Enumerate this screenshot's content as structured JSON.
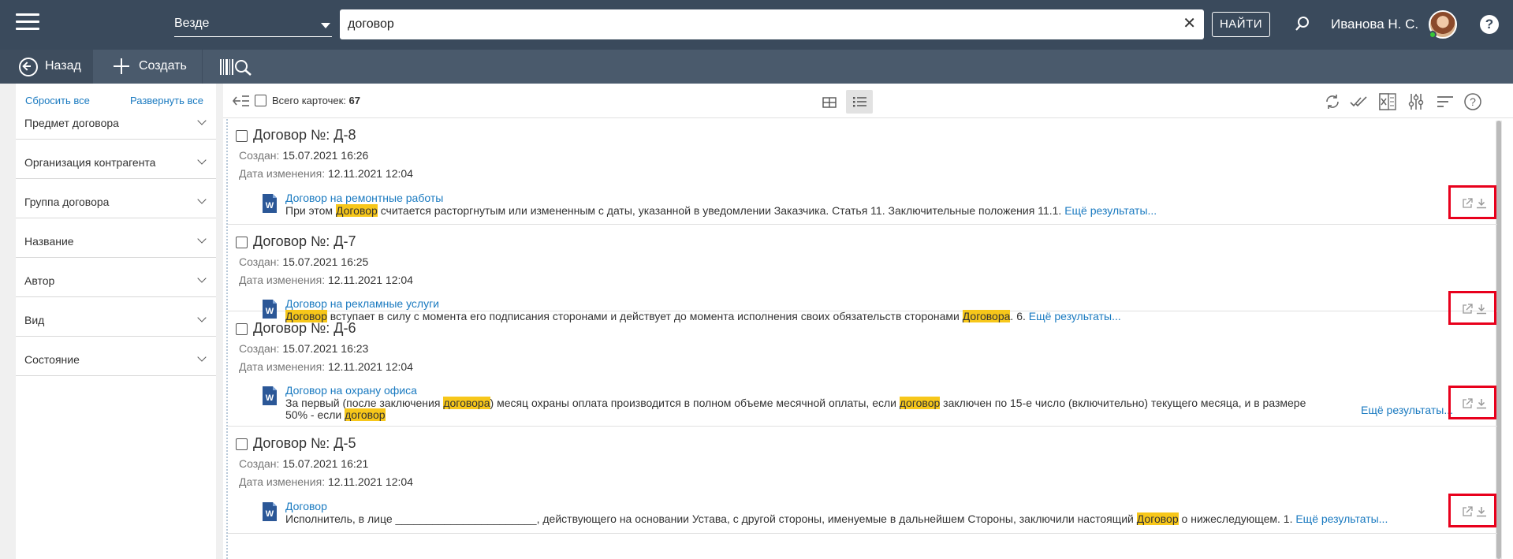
{
  "topbar": {
    "scope": "Везде",
    "search_value": "договор",
    "search_placeholder": "",
    "clear_glyph": "✕",
    "find_label": "НАЙТИ",
    "user_name": "Иванова Н. С.",
    "help_glyph": "?"
  },
  "toolbar": {
    "back_label": "Назад",
    "create_label": "Создать"
  },
  "filters": {
    "reset_label": "Сбросить все",
    "expand_label": "Развернуть все",
    "facets": [
      "Предмет договора",
      "Организация контрагента",
      "Группа договора",
      "Название",
      "Автор",
      "Вид",
      "Состояние"
    ]
  },
  "results": {
    "total_label": "Всего карточек:",
    "total_count": "67",
    "created_label": "Создан:",
    "modified_label": "Дата изменения:",
    "more_label": "Ещё результаты...",
    "cards": [
      {
        "title": "Договор №: Д-8",
        "created": "15.07.2021 16:26",
        "modified": "12.11.2021 12:04",
        "doc_title": "Договор на ремонтные работы",
        "snippet": [
          "При этом ",
          "Договор",
          " считается расторгнутым или измененным с даты, указанной в уведомлении Заказчика. Статья 11. Заключительные положения 11.1. "
        ]
      },
      {
        "title": "Договор №: Д-7",
        "created": "15.07.2021 16:25",
        "modified": "12.11.2021 12:04",
        "doc_title": "Договор на рекламные услуги",
        "snippet": [
          "Договор",
          " вступает в силу с момента его подписания сторонами и действует до момента исполнения своих обязательств сторонами ",
          "Договора",
          ". 6. "
        ]
      },
      {
        "title": "Договор №: Д-6",
        "created": "15.07.2021 16:23",
        "modified": "12.11.2021 12:04",
        "doc_title": "Договор на охрану офиса",
        "snippet": [
          "За первый (после заключения ",
          "договора",
          ") месяц охраны оплата производится в полном объеме месячной оплаты, если ",
          "договор",
          " заключен по 15-е число (включительно) текущего месяца, и в размере 50% - если ",
          "договор"
        ]
      },
      {
        "title": "Договор №: Д-5",
        "created": "15.07.2021 16:21",
        "modified": "12.11.2021 12:04",
        "doc_title": "Договор",
        "snippet": [
          "Исполнитель, в лице _______________________, действующего на основании Устава, с другой стороны, именуемые в дальнейшем Стороны, заключили настоящий ",
          "Договор",
          " о нижеследующем. 1. "
        ]
      }
    ]
  },
  "colors": {
    "topbar": "#3a4a5c",
    "toolbar": "#4a5a6c",
    "link": "#1a7ac0",
    "highlight": "#f7c71a",
    "annotation_box": "#e8001c"
  },
  "icons": [
    "menu-icon",
    "search-icon",
    "help-icon",
    "back-icon",
    "plus-icon",
    "barcode-search-icon",
    "collapse-panel-icon",
    "grid-view-icon",
    "list-view-icon",
    "refresh-icon",
    "check-all-icon",
    "excel-icon",
    "settings-sliders-icon",
    "sort-icon",
    "help-circle-icon",
    "word-doc-icon",
    "open-external-icon",
    "download-icon"
  ]
}
